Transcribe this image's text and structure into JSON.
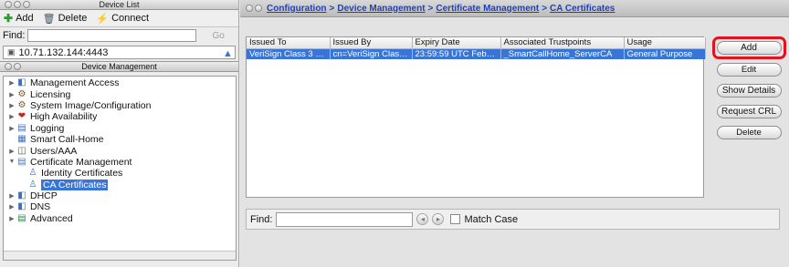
{
  "device_list": {
    "window_title": "Device List",
    "toolbar": {
      "add_label": "Add",
      "delete_label": "Delete",
      "connect_label": "Connect"
    },
    "find_label": "Find:",
    "find_go_label": "Go",
    "device_address": "10.71.132.144:4443"
  },
  "device_management": {
    "title": "Device Management",
    "tree": [
      {
        "label": "Management Access",
        "expander": "collapsed",
        "icon": "management-access-icon",
        "indent": 0
      },
      {
        "label": "Licensing",
        "expander": "collapsed",
        "icon": "licensing-icon",
        "indent": 0
      },
      {
        "label": "System Image/Configuration",
        "expander": "collapsed",
        "icon": "system-image-icon",
        "indent": 0
      },
      {
        "label": "High Availability",
        "expander": "collapsed",
        "icon": "high-availability-icon",
        "indent": 0
      },
      {
        "label": "Logging",
        "expander": "collapsed",
        "icon": "logging-icon",
        "indent": 0
      },
      {
        "label": "Smart Call-Home",
        "expander": "none",
        "icon": "smart-call-home-icon",
        "indent": 0
      },
      {
        "label": "Users/AAA",
        "expander": "collapsed",
        "icon": "users-aaa-icon",
        "indent": 0
      },
      {
        "label": "Certificate Management",
        "expander": "expanded",
        "icon": "certificate-management-icon",
        "indent": 0
      },
      {
        "label": "Identity Certificates",
        "expander": "none",
        "icon": "identity-certificates-icon",
        "indent": 1
      },
      {
        "label": "CA Certificates",
        "expander": "none",
        "icon": "ca-certificates-icon",
        "indent": 1,
        "selected": true
      },
      {
        "label": "DHCP",
        "expander": "collapsed",
        "icon": "dhcp-icon",
        "indent": 0
      },
      {
        "label": "DNS",
        "expander": "collapsed",
        "icon": "dns-icon",
        "indent": 0
      },
      {
        "label": "Advanced",
        "expander": "collapsed",
        "icon": "advanced-icon",
        "indent": 0
      }
    ]
  },
  "breadcrumb": [
    "Configuration",
    "Device Management",
    "Certificate Management",
    "CA Certificates"
  ],
  "breadcrumb_separator": ">",
  "ca_table": {
    "columns": [
      "Issued To",
      "Issued By",
      "Expiry Date",
      "Associated Trustpoints",
      "Usage"
    ],
    "rows": [
      [
        "VeriSign Class 3 Sec...",
        "cn=VeriSign Class 3...",
        "23:59:59 UTC Feb 7...",
        "_SmartCallHome_ServerCA",
        "General Purpose"
      ]
    ]
  },
  "actions": {
    "add": "Add",
    "edit": "Edit",
    "show_details": "Show Details",
    "request_crl": "Request CRL",
    "delete": "Delete"
  },
  "find_bar": {
    "label": "Find:",
    "match_case_label": "Match Case"
  },
  "colors": {
    "selection": "#3875d7",
    "link": "#1f3fbf",
    "highlight": "#e0141e"
  }
}
